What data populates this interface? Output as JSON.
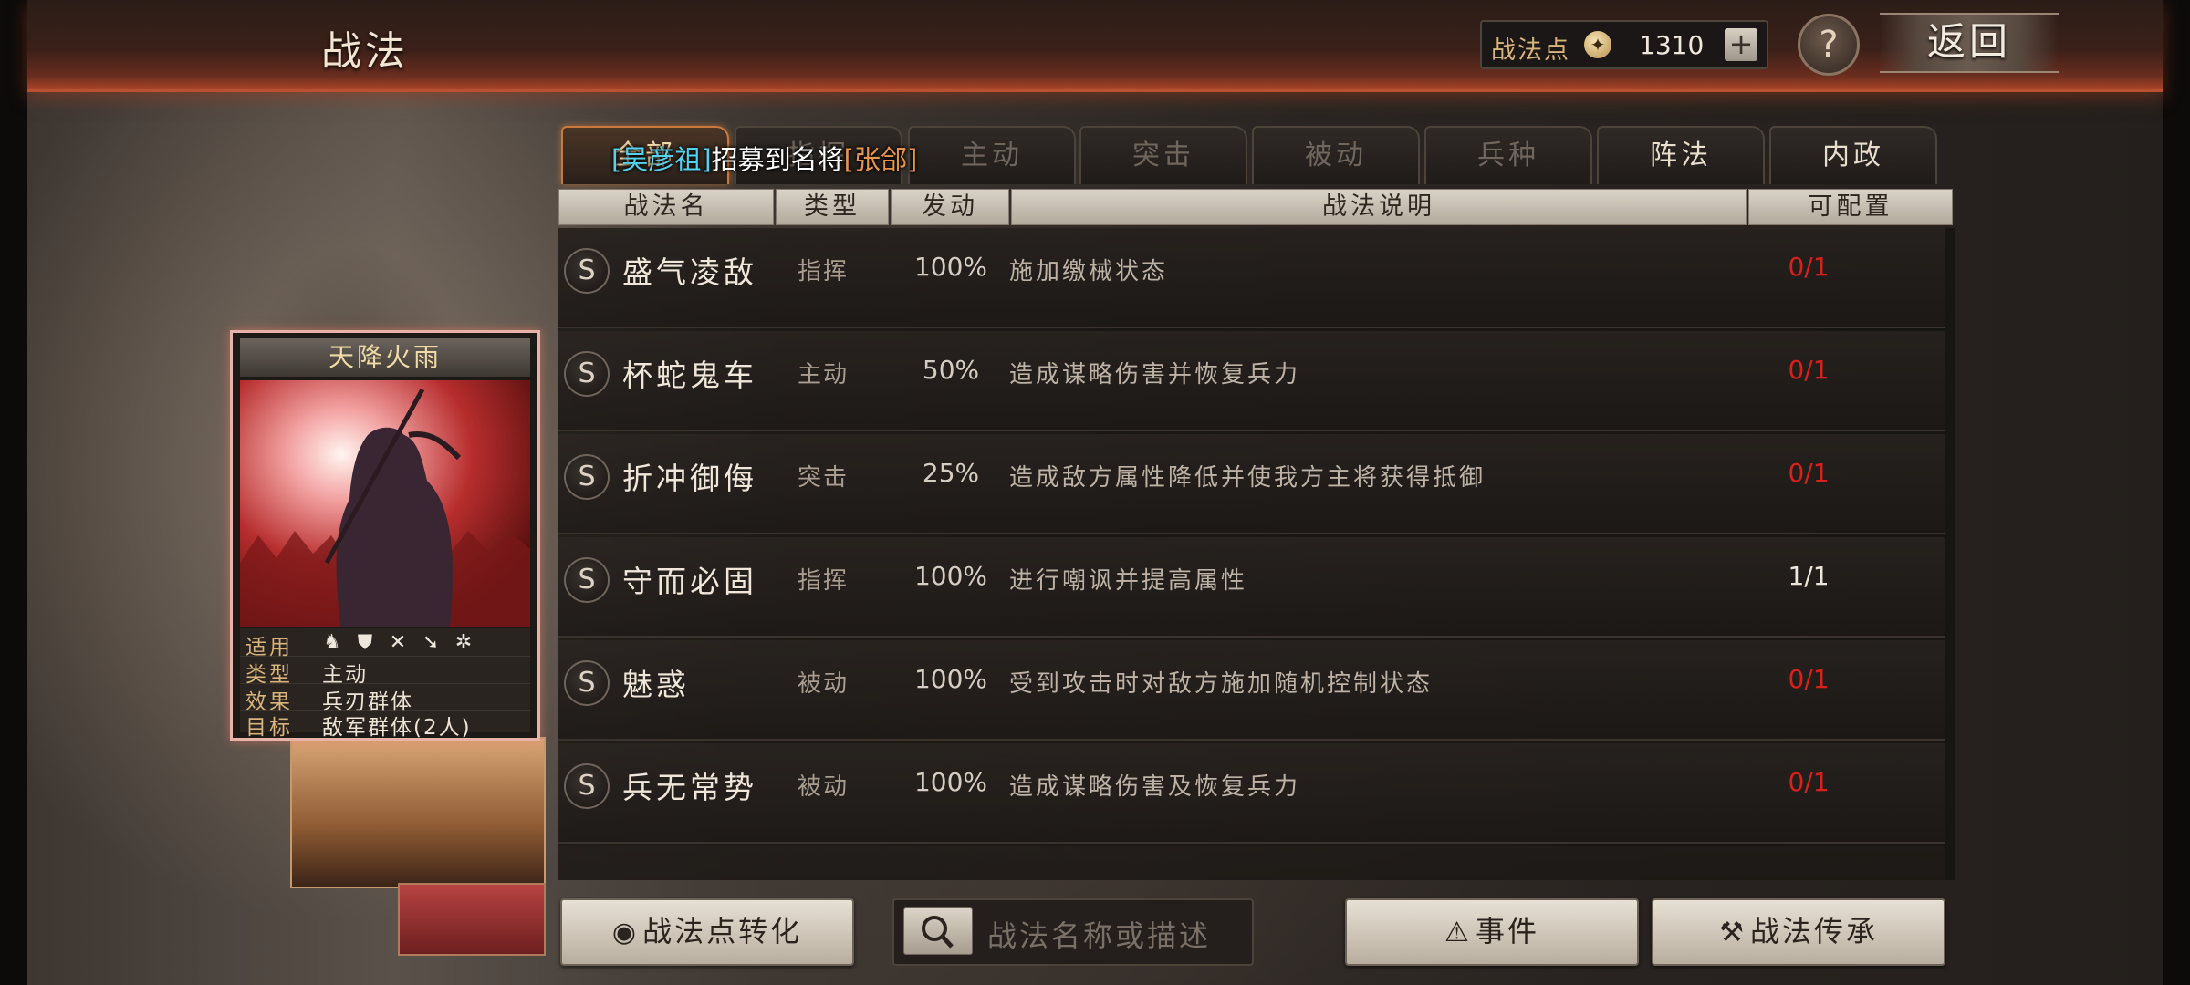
{
  "header": {
    "title": "战法"
  },
  "points": {
    "label": "战法点",
    "icon": "ink-drop-icon",
    "value": "1310",
    "add": "+"
  },
  "help": "?",
  "back": "返回",
  "tabs": [
    {
      "label": "全部",
      "active": true
    },
    {
      "label": "指挥"
    },
    {
      "label": "主动"
    },
    {
      "label": "突击"
    },
    {
      "label": "被动"
    },
    {
      "label": "兵种"
    },
    {
      "label": "阵法"
    },
    {
      "label": "内政"
    }
  ],
  "banner": {
    "player": "[吴彦祖]",
    "text": "招募到名将",
    "general": "[张郃]"
  },
  "columns": {
    "name": "战法名",
    "type": "类型",
    "rate": "发动",
    "desc": "战法说明",
    "slot": "可配置"
  },
  "skills": [
    {
      "grade": "S",
      "name": "盛气凌敌",
      "type": "指挥",
      "rate": "100%",
      "desc": "施加缴械状态",
      "slot": "0/1",
      "slot_color": "#d8201c"
    },
    {
      "grade": "S",
      "name": "杯蛇鬼车",
      "type": "主动",
      "rate": "50%",
      "desc": "造成谋略伤害并恢复兵力",
      "slot": "0/1",
      "slot_color": "#d8201c"
    },
    {
      "grade": "S",
      "name": "折冲御侮",
      "type": "突击",
      "rate": "25%",
      "desc": "造成敌方属性降低并使我方主将获得抵御",
      "slot": "0/1",
      "slot_color": "#d8201c"
    },
    {
      "grade": "S",
      "name": "守而必固",
      "type": "指挥",
      "rate": "100%",
      "desc": "进行嘲讽并提高属性",
      "slot": "1/1",
      "slot_color": "#ece6dc"
    },
    {
      "grade": "S",
      "name": "魅惑",
      "type": "被动",
      "rate": "100%",
      "desc": "受到攻击时对敌方施加随机控制状态",
      "slot": "0/1",
      "slot_color": "#d8201c"
    },
    {
      "grade": "S",
      "name": "兵无常势",
      "type": "被动",
      "rate": "100%",
      "desc": "造成谋略伤害及恢复兵力",
      "slot": "0/1",
      "slot_color": "#d8201c"
    }
  ],
  "card": {
    "title": "天降火雨",
    "applicable_label": "适用",
    "unit_icons": [
      "cavalry-icon",
      "shield-icon",
      "archer-icon",
      "spear-icon",
      "siege-icon"
    ],
    "type_label": "类型",
    "type_value": "主动",
    "effect_label": "效果",
    "effect_value": "兵刃群体",
    "target_label": "目标",
    "target_value": "敌军群体(2人)"
  },
  "bottom": {
    "convert_label": "战法点转化",
    "search_placeholder": "战法名称或描述",
    "events_label": "事件",
    "inherit_label": "战法传承"
  }
}
